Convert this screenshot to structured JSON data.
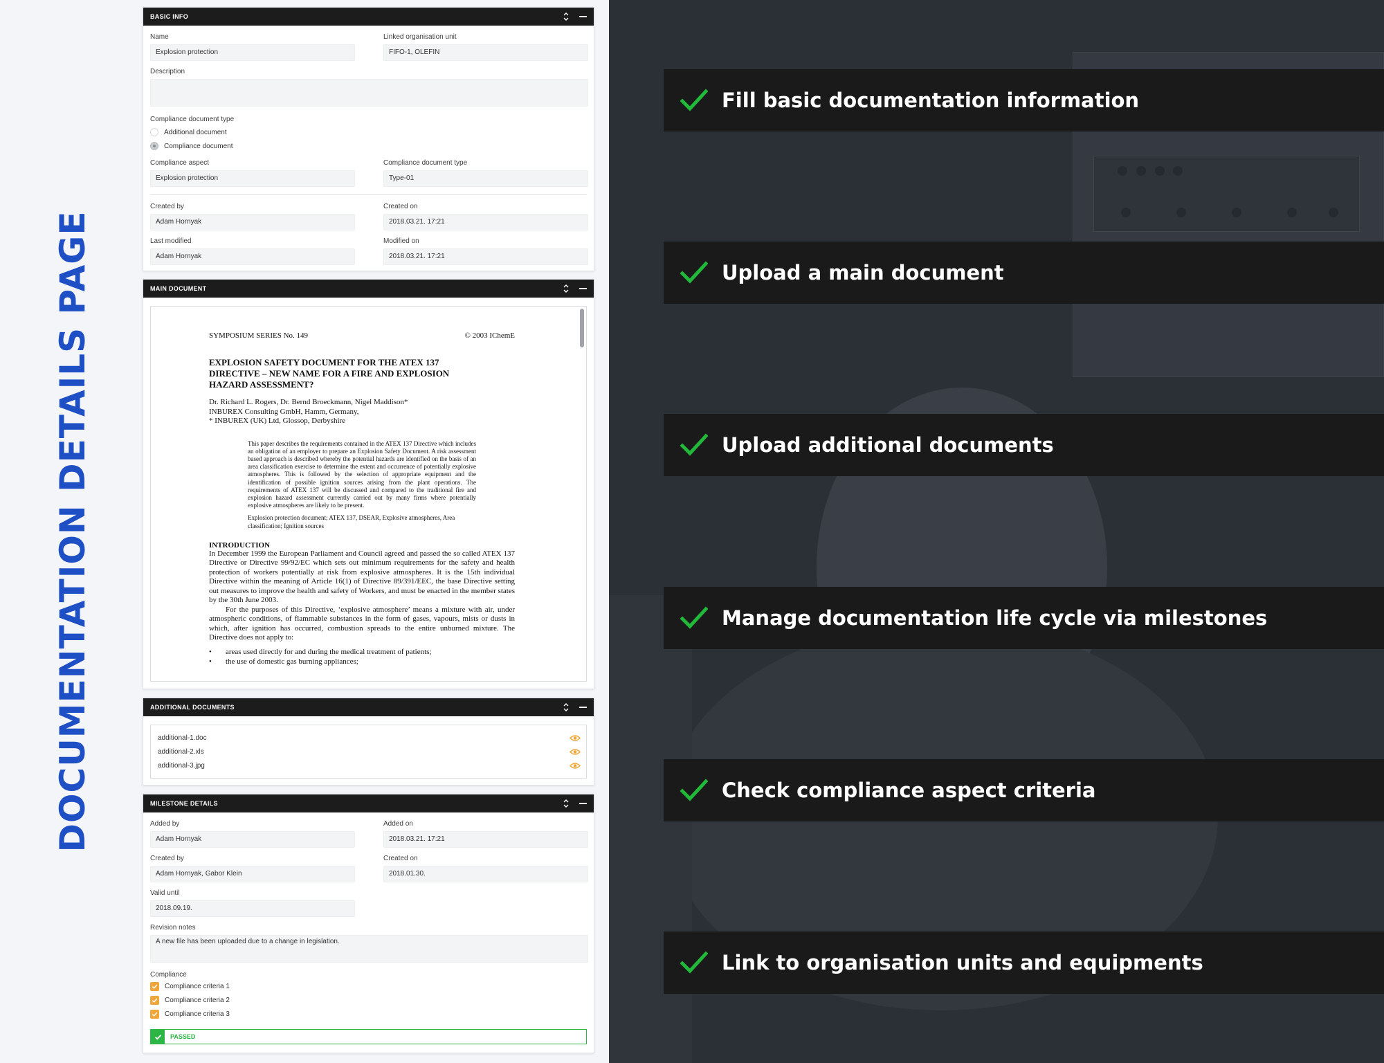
{
  "page_title": "DOCUMENTATION DETAILS PAGE",
  "basic_info": {
    "title": "BASIC INFO",
    "name_label": "Name",
    "name_value": "Explosion protection",
    "org_unit_label": "Linked organisation unit",
    "org_unit_value": "FIFO-1, OLEFIN",
    "description_label": "Description",
    "description_value": "",
    "doc_type_group_label": "Compliance document type",
    "radio_options": [
      "Additional document",
      "Compliance document"
    ],
    "selected_radio": "Compliance document",
    "aspect_label": "Compliance aspect",
    "aspect_value": "Explosion protection",
    "doc_type_label": "Compliance document type",
    "doc_type_value": "Type-01",
    "created_by_label": "Created by",
    "created_by_value": "Adam Hornyak",
    "created_on_label": "Created on",
    "created_on_value": "2018.03.21. 17:21",
    "last_modified_label": "Last modified",
    "last_modified_value": "Adam Hornyak",
    "modified_on_label": "Modified on",
    "modified_on_value": "2018.03.21. 17:21"
  },
  "main_document": {
    "title": "MAIN DOCUMENT",
    "series": "SYMPOSIUM SERIES No. 149",
    "copyright": "© 2003 IChemE",
    "doc_title": "EXPLOSION SAFETY DOCUMENT FOR THE ATEX 137\nDIRECTIVE – NEW NAME FOR A FIRE AND EXPLOSION\nHAZARD ASSESSMENT?",
    "authors": "Dr. Richard L. Rogers, Dr. Bernd Broeckmann, Nigel Maddison*\nINBUREX Consulting GmbH, Hamm, Germany,\n* INBUREX (UK) Ltd, Glossop, Derbyshire",
    "abstract": "This paper describes the requirements contained in the ATEX 137 Directive which includes an obligation of an employer to prepare an Explosion Safety Document. A risk assessment based approach is described whereby the potential hazards are identified on the basis of an area classification exercise to determine the extent and occurrence of potentially explosive atmospheres. This is followed by the selection of appropriate equipment and the identification of possible ignition sources arising from the plant operations. The requirements of ATEX 137 will be discussed and compared to the traditional fire and explosion hazard assessment currently carried out by many firms where potentially explosive atmospheres are likely to be present.",
    "keywords": "Explosion protection document; ATEX 137, DSEAR, Explosive atmospheres, Area classification; Ignition sources",
    "intro_heading": "INTRODUCTION",
    "intro_p1": "In December 1999 the European Parliament and Council agreed and passed the so called ATEX 137 Directive or Directive 99/92/EC which sets out minimum requirements for the safety and health protection of workers potentially at risk from explosive atmospheres. It is the 15th individual Directive within the meaning of Article 16(1) of Directive 89/391/EEC, the base Directive setting out measures to improve the health and safety of Workers, and must be enacted in the member states by the 30th June 2003.",
    "intro_p2": "For the purposes of this Directive, ‘explosive atmosphere’ means a mixture with air, under atmospheric conditions, of flammable substances in the form of gases, vapours, mists or dusts in which, after ignition has occurred, combustion spreads to the entire unburned mixture. The Directive does not apply to:",
    "bullets": [
      "areas used directly for and during the medical treatment of patients;",
      "the use of domestic gas burning appliances;"
    ]
  },
  "additional_documents": {
    "title": "ADDITIONAL DOCUMENTS",
    "files": [
      "additional-1.doc",
      "additional-2.xls",
      "additional-3.jpg"
    ]
  },
  "milestone_details": {
    "title": "MILESTONE DETAILS",
    "added_by_label": "Added by",
    "added_by_value": "Adam Hornyak",
    "added_on_label": "Added on",
    "added_on_value": "2018.03.21. 17:21",
    "created_by_label": "Created by",
    "created_by_value": "Adam Hornyak, Gabor Klein",
    "created_on_label": "Created on",
    "created_on_value": "2018.01.30.",
    "valid_until_label": "Valid until",
    "valid_until_value": "2018.09.19.",
    "revision_label": "Revision notes",
    "revision_value": "A new file has been uploaded due to a change in legislation.",
    "compliance_label": "Compliance",
    "criteria": [
      "Compliance criteria 1",
      "Compliance criteria 2",
      "Compliance criteria 3"
    ],
    "status": "PASSED"
  },
  "features": [
    "Fill basic documentation information",
    "Upload a main document",
    "Upload additional documents",
    "Manage documentation life cycle via milestones",
    "Check compliance aspect criteria",
    "Link to organisation units and equipments"
  ],
  "colors": {
    "title_blue": "#1f4fc4",
    "check_green": "#22b83a",
    "header_dark": "#1c1c1c",
    "checkbox_orange": "#f0a63a",
    "passed_green": "#2db546",
    "eye_orange": "#f0a63a"
  },
  "icons": {
    "panel_sort": "chevron-up-down-icon",
    "panel_minimize": "minimize-icon",
    "file_view": "eye-icon",
    "feature": "check-icon"
  }
}
